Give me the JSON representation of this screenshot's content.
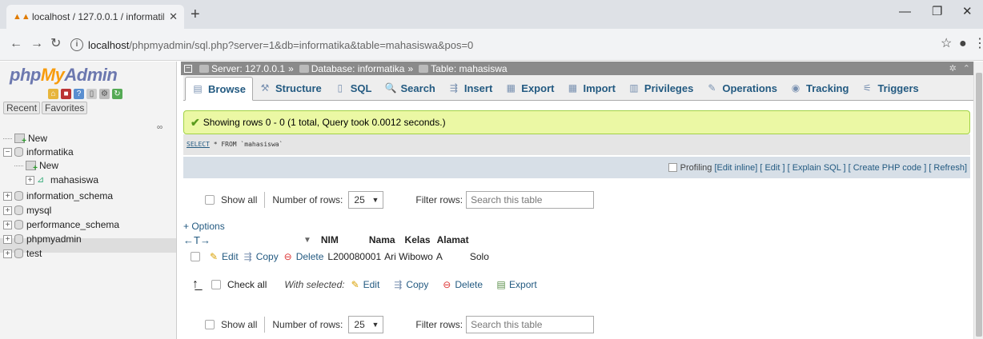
{
  "browser": {
    "tab_title": "localhost / 127.0.0.1 / informatik",
    "url_host": "localhost",
    "url_path": "/phpmyadmin/sql.php?server=1&db=informatika&table=mahasiswa&pos=0"
  },
  "sidebar": {
    "logo_php": "php",
    "logo_my": "My",
    "logo_admin": "Admin",
    "recent": "Recent",
    "favorites": "Favorites",
    "tree": [
      {
        "label": "New"
      },
      {
        "label": "informatika"
      },
      {
        "label": "New"
      },
      {
        "label": "mahasiswa"
      },
      {
        "label": "information_schema"
      },
      {
        "label": "mysql"
      },
      {
        "label": "performance_schema"
      },
      {
        "label": "phpmyadmin"
      },
      {
        "label": "test"
      }
    ]
  },
  "breadcrumb": {
    "server": "Server: 127.0.0.1",
    "database": "Database: informatika",
    "table": "Table: mahasiswa",
    "sep": "»"
  },
  "tabs": [
    {
      "label": "Browse",
      "icon": "▤"
    },
    {
      "label": "Structure",
      "icon": "⚒"
    },
    {
      "label": "SQL",
      "icon": "▯"
    },
    {
      "label": "Search",
      "icon": "🔍"
    },
    {
      "label": "Insert",
      "icon": "⇶"
    },
    {
      "label": "Export",
      "icon": "▦"
    },
    {
      "label": "Import",
      "icon": "▦"
    },
    {
      "label": "Privileges",
      "icon": "▥"
    },
    {
      "label": "Operations",
      "icon": "✎"
    },
    {
      "label": "Tracking",
      "icon": "◉"
    },
    {
      "label": "Triggers",
      "icon": "⚟"
    }
  ],
  "message": {
    "text": "Showing rows 0 - 0 (1 total, Query took 0.0012 seconds.)"
  },
  "sql": {
    "select": "SELECT",
    "rest": " * FROM `mahasiswa`"
  },
  "tools": {
    "profiling": "Profiling",
    "edit_inline": "[Edit inline]",
    "edit": "[ Edit ]",
    "explain": "[ Explain SQL ]",
    "create_php": "[ Create PHP code ]",
    "refresh": "[ Refresh]"
  },
  "filter": {
    "show_all": "Show all",
    "number_of_rows": "Number of rows:",
    "rows_value": "25",
    "filter_rows": "Filter rows:",
    "search_placeholder": "Search this table"
  },
  "table": {
    "options": "+ Options",
    "arrows": "←T→",
    "columns": [
      "NIM",
      "Nama",
      "Kelas",
      "Alamat"
    ],
    "row": {
      "edit": "Edit",
      "copy": "Copy",
      "delete": "Delete",
      "nim": "L200080001",
      "nama": "Ari Wibowo",
      "kelas": "A",
      "alamat": "Solo"
    }
  },
  "bulk": {
    "check_all": "Check all",
    "with_selected": "With selected:",
    "edit": "Edit",
    "copy": "Copy",
    "delete": "Delete",
    "export": "Export"
  }
}
